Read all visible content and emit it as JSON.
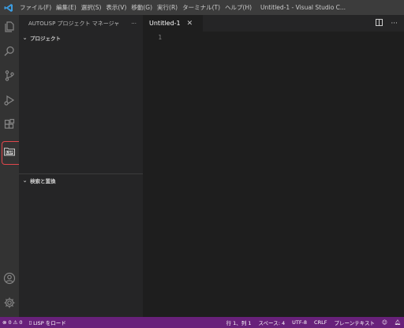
{
  "titlebar": {
    "menu": [
      "ファイル(F)",
      "編集(E)",
      "選択(S)",
      "表示(V)",
      "移動(G)",
      "実行(R)",
      "ターミナル(T)",
      "ヘルプ(H)"
    ],
    "window_title": "Untitled-1 - Visual Studio C..."
  },
  "activity_bar": {
    "icons": [
      "explorer-icon",
      "search-icon",
      "source-control-icon",
      "run-debug-icon",
      "extensions-icon",
      "autolisp-project-icon",
      "account-icon",
      "settings-gear-icon"
    ],
    "highlight_color": "#e0474c"
  },
  "sidebar": {
    "header_title": "AUTOLISP プロジェクト マネージャ",
    "more_label": "···",
    "project_section": "プロジェクト",
    "search_section": "検索と置換"
  },
  "editor": {
    "tab_label": "Untitled-1",
    "tab_close": "✕",
    "line_numbers": [
      "1"
    ]
  },
  "statusbar": {
    "errors": "0",
    "warnings": "0",
    "lisp_label": "LISP をロード",
    "cursor": "行 1、列 1",
    "spaces": "スペース: 4",
    "encoding": "UTF-8",
    "eol": "CRLF",
    "language": "プレーンテキスト",
    "color": "#68217a"
  }
}
